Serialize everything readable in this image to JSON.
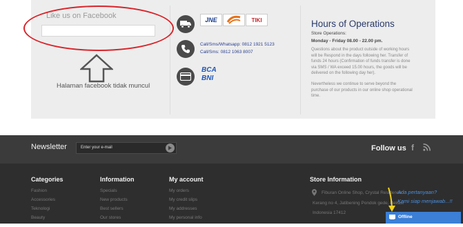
{
  "facebook": {
    "title": "Like us on Facebook",
    "note": "Halaman facebook tidak muncul"
  },
  "shipping": {
    "logos": [
      "JNE",
      "POS",
      "TIKI"
    ]
  },
  "contact": {
    "line1": "Call/Sms/Whatsapp:  0812 1921 5123",
    "line2": "Call/Sms:   0812 1063 8007"
  },
  "banks": {
    "logos": [
      "BCA",
      "BNI"
    ]
  },
  "hours": {
    "title": "Hours of Operations",
    "subtitle": "Store Operations:",
    "time": "Monday - Friday 08.00 - 22.00 pm.",
    "para1": [
      "Questions about the product outside of working hours",
      "will be Respond in the days following her. Transfer of",
      "funds 24 hours (Confirmation of funds transfer is done",
      "via SMS / WA exceed 15.00 hours, the goods will be",
      "delivered on the following day her)."
    ],
    "para2": [
      "Nevertheless we continue to serve beyond the",
      "purchase of our products in our online shop operational",
      "time."
    ]
  },
  "newsletter": {
    "title": "Newsletter",
    "placeholder": "Enter your e-mail"
  },
  "follow": {
    "title": "Follow us"
  },
  "categories": {
    "title": "Categories",
    "items": [
      "Fashion",
      "Accessories",
      "Teknologi",
      "Beauty"
    ]
  },
  "information": {
    "title": "Information",
    "items": [
      "Specials",
      "New products",
      "Best sellers",
      "Our stores"
    ]
  },
  "account": {
    "title": "My account",
    "items": [
      "My orders",
      "My credit slips",
      "My addresses",
      "My personal info"
    ]
  },
  "store": {
    "title": "Store Information",
    "lines": [
      "Fiburan Online Shop, Crystal Residence",
      "Kerang no 4, Jatibening Pondok gede, Bekasi",
      "Indonesia 17412"
    ]
  },
  "chat": {
    "question": "Ada pertanyaan?",
    "answer": "Kami siap menjawab...!!",
    "status": "Offline"
  },
  "colors": {
    "footer_bg": "#3b3b3b",
    "footer_lower_bg": "#2e2e2e",
    "panel_bg": "#ededed",
    "highlight_red": "#d9242a",
    "chat_blue": "#3b7fd6",
    "hours_title": "#2a3a6a"
  },
  "icons": [
    "truck-icon",
    "phone-icon",
    "credit-card-icon",
    "arrow-up-icon",
    "submit-arrow-icon",
    "facebook-icon",
    "rss-icon",
    "map-pin-icon",
    "mail-icon"
  ]
}
